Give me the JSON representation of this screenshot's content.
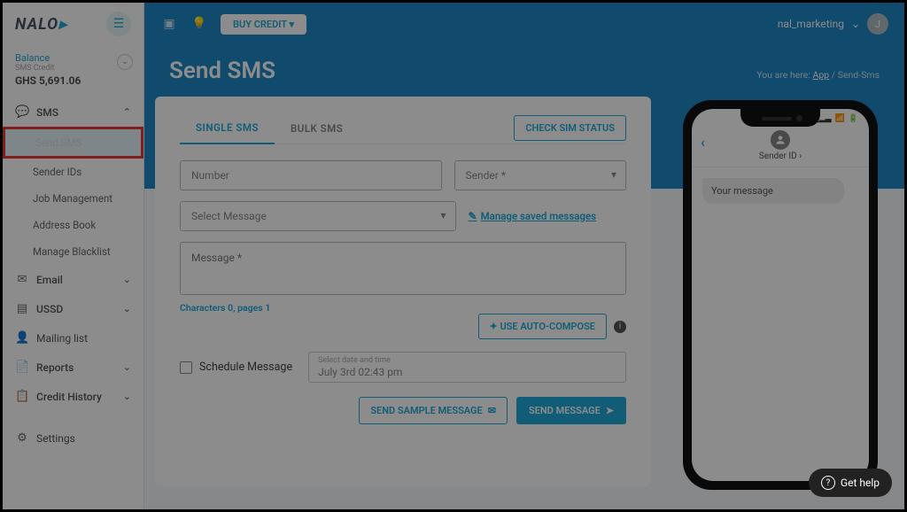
{
  "logo": {
    "text": "NALO"
  },
  "balance": {
    "label": "Balance",
    "sub": "SMS Credit",
    "amount": "GHS 5,691.06"
  },
  "topbar": {
    "buy_credit": "BUY CREDIT",
    "user_name": "nal_marketing",
    "user_initial": "J"
  },
  "page": {
    "title": "Send SMS"
  },
  "breadcrumb": {
    "prefix": "You are here:",
    "app": "App",
    "current": "Send-Sms"
  },
  "sidebar": {
    "sms": {
      "label": "SMS",
      "subs": [
        "Send SMS",
        "Sender IDs",
        "Job Management",
        "Address Book",
        "Manage Blacklist"
      ]
    },
    "email": "Email",
    "ussd": "USSD",
    "mailing": "Mailing list",
    "reports": "Reports",
    "credit": "Credit History",
    "settings": "Settings"
  },
  "tabs": {
    "single": "SINGLE SMS",
    "bulk": "BULK SMS",
    "check_sim": "CHECK SIM STATUS"
  },
  "form": {
    "number_ph": "Number",
    "sender_ph": "Sender *",
    "select_msg_ph": "Select Message",
    "manage_link": "Manage saved messages",
    "message_ph": "Message *",
    "char_label_a": "Characters",
    "char_count": "0",
    "char_label_b": "pages",
    "page_count": "1",
    "auto_compose": "USE AUTO-COMPOSE",
    "schedule_label": "Schedule Message",
    "dt_label": "Select date and time",
    "dt_value": "July 3rd 02:43 pm",
    "send_sample": "SEND SAMPLE MESSAGE",
    "send": "SEND MESSAGE"
  },
  "phone": {
    "sender_label": "Sender ID",
    "msg_placeholder": "Your message"
  },
  "help": {
    "label": "Get help"
  }
}
